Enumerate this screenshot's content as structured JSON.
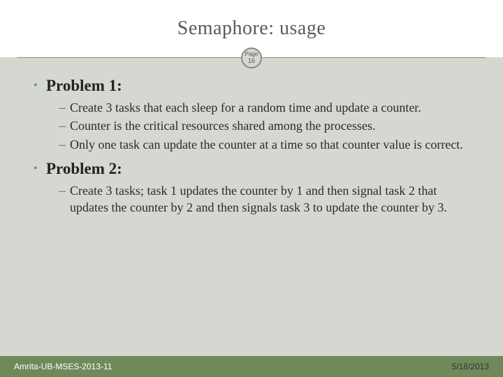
{
  "header": {
    "title": "Semaphore: usage",
    "page_label": "Page",
    "page_number": "16"
  },
  "content": {
    "problems": [
      {
        "heading": "Problem 1:",
        "items": [
          "Create 3 tasks that each sleep for a random time and update a counter.",
          "Counter is the critical resources shared among the processes.",
          "Only one task can update the counter at a time so that counter value is correct."
        ]
      },
      {
        "heading": "Problem 2:",
        "items": [
          "Create 3 tasks; task 1 updates the counter by 1  and then signal task 2 that updates the counter by 2 and then signals task 3 to update the counter by 3."
        ]
      }
    ]
  },
  "footer": {
    "left": "Amrita-UB-MSES-2013-11",
    "right": "5/18/2013"
  }
}
